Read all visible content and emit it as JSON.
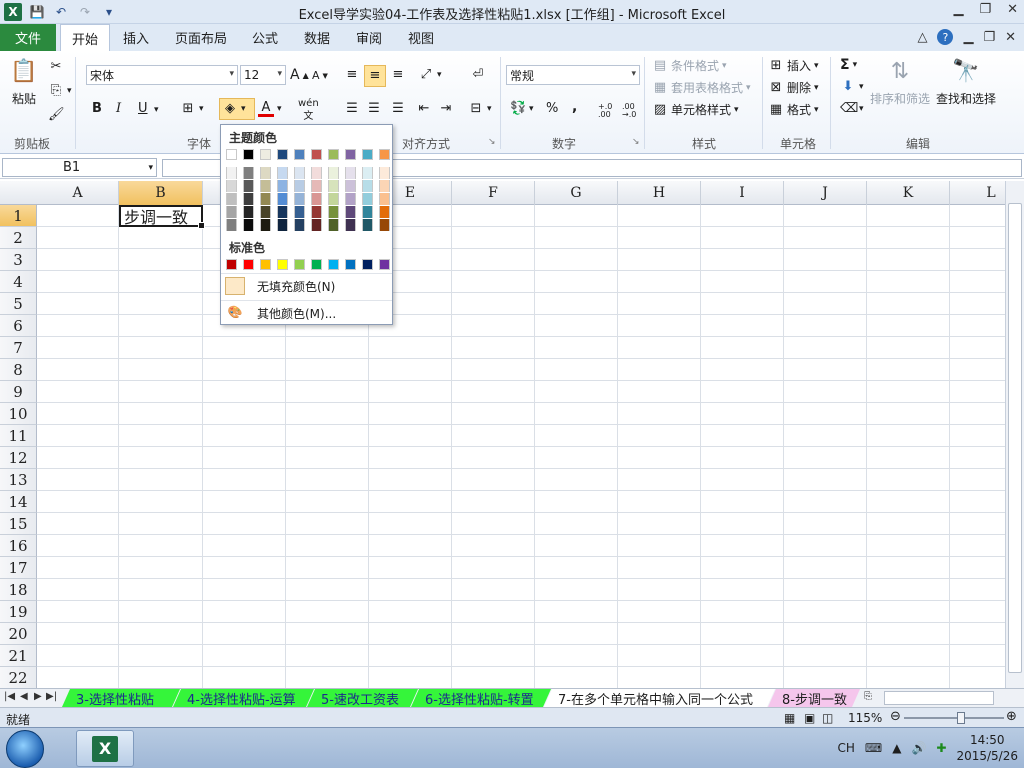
{
  "titlebar": {
    "title": "Excel导学实验04-工作表及选择性粘贴1.xlsx  [工作组] - Microsoft Excel",
    "logo_letter": "X"
  },
  "tabs": {
    "file": "文件",
    "items": [
      "开始",
      "插入",
      "页面布局",
      "公式",
      "数据",
      "审阅",
      "视图"
    ],
    "active": "开始"
  },
  "ribbon": {
    "clipboard": {
      "paste": "粘贴",
      "label": "剪贴板"
    },
    "font": {
      "name": "宋体",
      "size": "12",
      "label": "字体",
      "bold": "B",
      "italic": "I",
      "underline": "U",
      "wen": "wén"
    },
    "alignment": {
      "label": "对齐方式"
    },
    "number": {
      "format": "常规",
      "label": "数字",
      "percent": "%",
      "comma": ",",
      "inc_decimal": "+.0 .00",
      "dec_decimal": ".00 →.0"
    },
    "styles": {
      "conditional": "条件格式",
      "table": "套用表格格式",
      "cell": "单元格样式",
      "label": "样式"
    },
    "cells": {
      "insert": "插入",
      "delete": "删除",
      "format": "格式",
      "label": "单元格"
    },
    "editing": {
      "sum": "Σ",
      "sort": "排序和筛选",
      "find": "查找和选择",
      "label": "编辑"
    }
  },
  "formula_bar": {
    "name_box": "B1",
    "formula": ""
  },
  "grid": {
    "columns": [
      "A",
      "B",
      "C",
      "D",
      "E",
      "F",
      "G",
      "H",
      "I",
      "J",
      "K",
      "L"
    ],
    "rows": [
      "1",
      "2",
      "3",
      "4",
      "5",
      "6",
      "7",
      "8",
      "9",
      "10",
      "11",
      "12",
      "13",
      "14",
      "15",
      "16",
      "17",
      "18",
      "19",
      "20",
      "21",
      "22"
    ],
    "selected_column": "B",
    "selected_row": "1",
    "cell_b1": "步调一致"
  },
  "color_picker": {
    "theme_title": "主题颜色",
    "theme_colors": [
      "#ffffff",
      "#000000",
      "#eeece1",
      "#1f497d",
      "#4f81bd",
      "#c0504d",
      "#9bbb59",
      "#8064a2",
      "#4bacc6",
      "#f79646"
    ],
    "theme_shades": [
      [
        "#f2f2f2",
        "#d8d8d8",
        "#bfbfbf",
        "#a5a5a5",
        "#7f7f7f"
      ],
      [
        "#7f7f7f",
        "#595959",
        "#3f3f3f",
        "#262626",
        "#0c0c0c"
      ],
      [
        "#ddd9c3",
        "#c4bd97",
        "#938953",
        "#494429",
        "#1d1b10"
      ],
      [
        "#c6d9f0",
        "#8db3e2",
        "#548dd4",
        "#17365d",
        "#0f243e"
      ],
      [
        "#dbe5f1",
        "#b8cce4",
        "#95b3d7",
        "#366092",
        "#244061"
      ],
      [
        "#f2dcdb",
        "#e5b9b7",
        "#d99694",
        "#953734",
        "#632423"
      ],
      [
        "#ebf1dd",
        "#d7e3bc",
        "#c3d69b",
        "#76923c",
        "#4f6128"
      ],
      [
        "#e5e0ec",
        "#ccc1d9",
        "#b2a2c7",
        "#5f497a",
        "#3f3151"
      ],
      [
        "#dbeef3",
        "#b7dde8",
        "#92cddc",
        "#31859b",
        "#205867"
      ],
      [
        "#fdeada",
        "#fbd5b5",
        "#fac08f",
        "#e36c09",
        "#974806"
      ]
    ],
    "standard_title": "标准色",
    "standard_colors": [
      "#c00000",
      "#ff0000",
      "#ffc000",
      "#ffff00",
      "#92d050",
      "#00b050",
      "#00b0f0",
      "#0070c0",
      "#002060",
      "#7030a0"
    ],
    "no_fill": "无填充颜色(N)",
    "more_colors": "其他颜色(M)..."
  },
  "sheets": [
    {
      "name": "3-选择性粘贴",
      "style": "green"
    },
    {
      "name": "4-选择性粘贴-运算",
      "style": "green"
    },
    {
      "name": "5-速改工资表",
      "style": "green"
    },
    {
      "name": "6-选择性粘贴-转置",
      "style": "green"
    },
    {
      "name": "7-在多个单元格中输入同一个公式",
      "style": "white"
    },
    {
      "name": "8-步调一致",
      "style": "pink"
    }
  ],
  "status": {
    "text": "就绪",
    "zoom": "115%",
    "zoom_fraction": 0.57
  },
  "taskbar": {
    "lang": "CH",
    "time": "14:50",
    "date": "2015/5/26"
  }
}
